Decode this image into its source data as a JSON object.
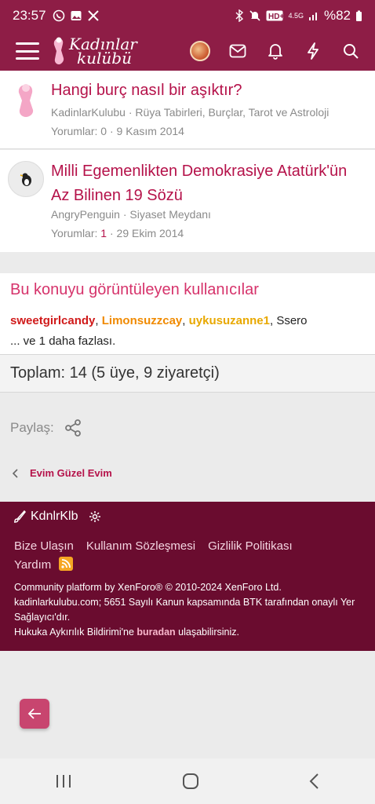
{
  "status": {
    "time": "23:57",
    "network": "4.5G",
    "battery": "%82"
  },
  "header": {
    "logo_line1": "Kadınlar",
    "logo_line2": "kulübü"
  },
  "threads": [
    {
      "title": "Hangi burç nasıl bir aşıktır?",
      "author": "KadinlarKulubu",
      "forum": "Rüya Tabirleri, Burçlar, Tarot ve Astroloji",
      "replies_label": "Yorumlar:",
      "replies": "0",
      "date": "9 Kasım 2014"
    },
    {
      "title": "Milli Egemenlikten Demokrasiye Atatürk'ün Az Bilinen 19 Sözü",
      "author": "AngryPenguin",
      "forum": "Siyaset Meydanı",
      "replies_label": "Yorumlar:",
      "replies": "1",
      "date": "29 Ekim 2014"
    }
  ],
  "viewers": {
    "heading": "Bu konuyu görüntüleyen kullanıcılar",
    "users": [
      "sweetgirlcandy",
      "Limonsuzzcay",
      "uykusuzanne1",
      "Ssero"
    ],
    "more": "... ve 1 daha fazlası.",
    "total": "Toplam: 14 (5 üye, 9 ziyaretçi)"
  },
  "share_label": "Paylaş:",
  "breadcrumb": "Evim Güzel Evim",
  "footer": {
    "brand": "KdnlrKlb",
    "links": [
      "Bize Ulaşın",
      "Kullanım Sözleşmesi",
      "Gizlilik Politikası",
      "Yardım"
    ],
    "legal_line1": "Community platform by XenForo® © 2010-2024 XenForo Ltd.",
    "legal_line2": "kadinlarkulubu.com; 5651 Sayılı Kanun kapsamında BTK tarafından onaylı Yer Sağlayıcı'dır.",
    "legal_line3_pre": "Hukuka Aykırılık Bildirimi'ne ",
    "legal_line3_link": "buradan",
    "legal_line3_post": " ulaşabilirsiniz."
  },
  "colors": {
    "brand": "#8e1d46",
    "footer": "#6a0c2f",
    "link": "#b5124a"
  }
}
